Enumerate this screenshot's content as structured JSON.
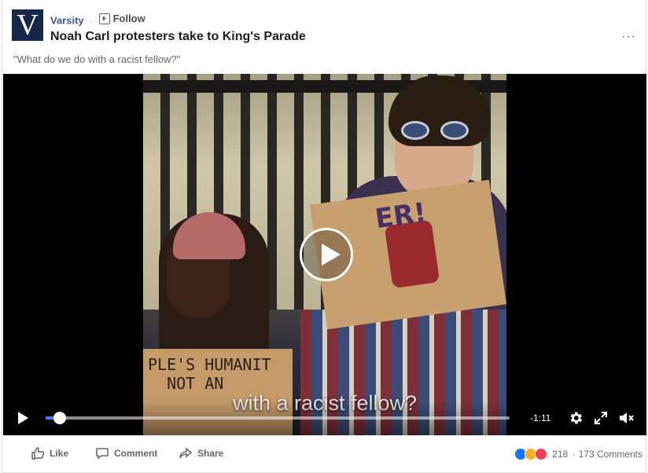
{
  "post": {
    "page_name": "Varsity",
    "separator": "·",
    "follow_label": "Follow",
    "title": "Noah Carl protesters take to King's Parade",
    "more_label": "···",
    "caption": "\"What do we do with a racist fellow?\"",
    "logo_letter": "V"
  },
  "video": {
    "subtitle": "with a racist fellow?",
    "time_remaining": "-1:11",
    "progress": 0.03,
    "sign_right_text": "ER!",
    "sign_left_text": "PLE'S HUMANIT\n  NOT AN",
    "colors": {
      "progress": "#4080ff",
      "logo_bg": "#16274a"
    }
  },
  "actions": {
    "like_label": "Like",
    "comment_label": "Comment",
    "share_label": "Share"
  },
  "stats": {
    "reaction_icons": [
      "like-icon",
      "haha-icon",
      "love-icon"
    ],
    "reaction_count": "218",
    "comments_text": "· 173 Comments"
  }
}
